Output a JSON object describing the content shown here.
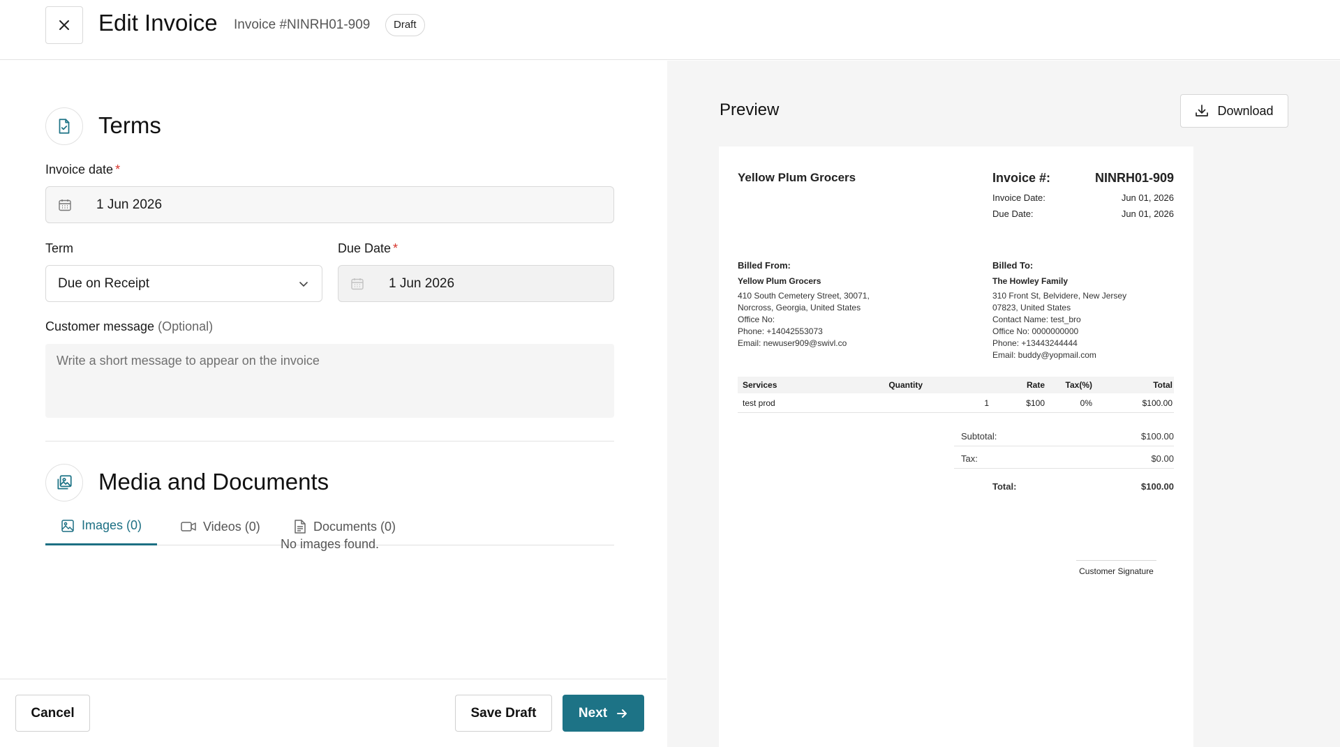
{
  "header": {
    "title": "Edit Invoice",
    "invoice_sub": "Invoice #NINRH01-909",
    "status": "Draft"
  },
  "terms": {
    "section_title": "Terms",
    "invoice_date_label": "Invoice date",
    "required_mark": "*",
    "invoice_date_value": "1 Jun 2026",
    "term_label": "Term",
    "term_value": "Due on Receipt",
    "due_date_label": "Due Date",
    "due_date_value": "1 Jun 2026",
    "customer_message_label": "Customer message",
    "customer_message_optional": "(Optional)",
    "customer_message_placeholder": "Write a short message to appear on the invoice"
  },
  "media": {
    "section_title": "Media and Documents",
    "tabs": [
      {
        "label": "Images (0)",
        "icon": "image-icon",
        "active": true
      },
      {
        "label": "Videos (0)",
        "icon": "video-icon",
        "active": false
      },
      {
        "label": "Documents (0)",
        "icon": "document-icon",
        "active": false
      }
    ],
    "empty_text": "No images found."
  },
  "footer": {
    "cancel_label": "Cancel",
    "save_draft_label": "Save Draft",
    "next_label": "Next"
  },
  "preview": {
    "title": "Preview",
    "download_label": "Download",
    "doc": {
      "company": "Yellow Plum Grocers",
      "invoice_label": "Invoice #:",
      "invoice_number": "NINRH01-909",
      "invoice_date_label": "Invoice Date:",
      "invoice_date": "Jun 01, 2026",
      "due_date_label": "Due Date:",
      "due_date": "Jun 01, 2026",
      "billed_from": {
        "label": "Billed From:",
        "name": "Yellow Plum Grocers",
        "lines": [
          "410 South Cemetery Street, 30071,",
          "Norcross, Georgia, United States",
          "Office No:",
          "Phone: +14042553073",
          "Email: newuser909@swivl.co"
        ]
      },
      "billed_to": {
        "label": "Billed To:",
        "name": "The Howley Family",
        "lines": [
          "310 Front St, Belvidere, New Jersey",
          "07823, United States",
          "Contact Name: test_bro",
          "Office No: 0000000000",
          "Phone: +13443244444",
          "Email: buddy@yopmail.com"
        ]
      },
      "table": {
        "headers": [
          "Services",
          "Quantity",
          "Rate",
          "Tax(%)",
          "Total"
        ],
        "rows": [
          [
            "test prod",
            "1",
            "$100",
            "0%",
            "$100.00"
          ]
        ]
      },
      "subtotal_label": "Subtotal:",
      "subtotal": "$100.00",
      "tax_label": "Tax:",
      "tax": "$0.00",
      "total_label": "Total:",
      "total": "$100.00",
      "signature_label": "Customer Signature"
    }
  },
  "colors": {
    "accent": "#1d7386",
    "required": "#d6342c"
  }
}
